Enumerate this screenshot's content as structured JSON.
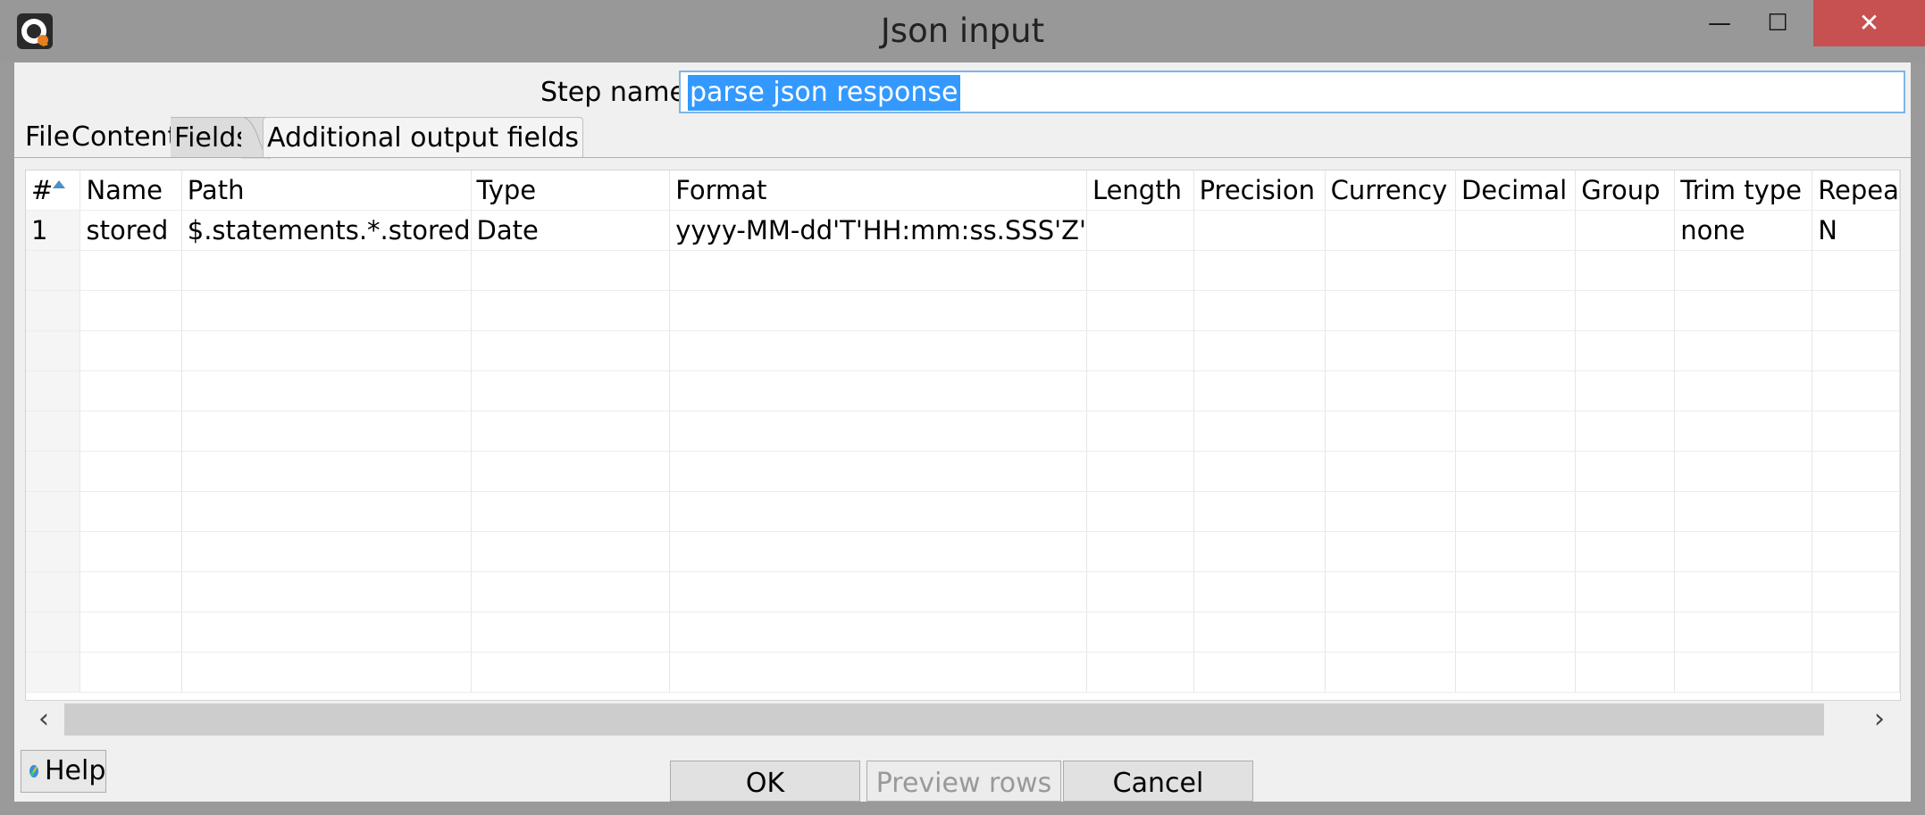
{
  "window": {
    "title": "Json input",
    "minimize_glyph": "—",
    "maximize_glyph": "☐",
    "close_glyph": "✕"
  },
  "step": {
    "label": "Step name",
    "value": "parse json response"
  },
  "tabs": [
    {
      "label": "File",
      "active": false
    },
    {
      "label": "Content",
      "active": false
    },
    {
      "label": "Fields",
      "active": true
    },
    {
      "label": "Additional output fields",
      "active": false
    }
  ],
  "table": {
    "columns": [
      "#",
      "Name",
      "Path",
      "Type",
      "Format",
      "Length",
      "Precision",
      "Currency",
      "Decimal",
      "Group",
      "Trim type",
      "Repea"
    ],
    "rows": [
      [
        "1",
        "stored",
        "$.statements.*.stored",
        "Date",
        "yyyy-MM-dd'T'HH:mm:ss.SSS'Z'",
        "",
        "",
        "",
        "",
        "",
        "none",
        "N"
      ]
    ],
    "empty_rows": 11
  },
  "scrollbar": {
    "left_arrow": "‹",
    "right_arrow": "›"
  },
  "buttons": {
    "help": "Help",
    "ok": "OK",
    "preview": "Preview rows",
    "cancel": "Cancel"
  },
  "colors": {
    "selection": "#3399ff",
    "input_border": "#7eb4ea",
    "close_button": "#c75050"
  }
}
